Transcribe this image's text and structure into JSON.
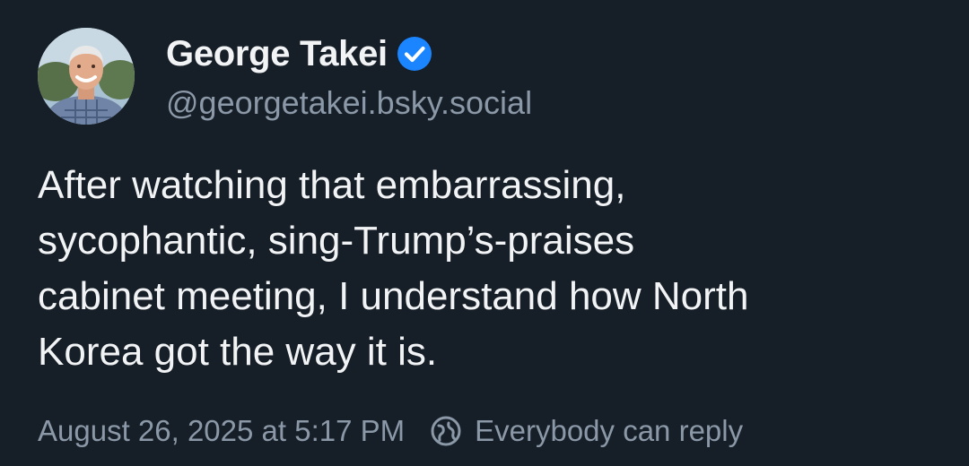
{
  "author": {
    "display_name": "George Takei",
    "handle": "@georgetakei.bsky.social",
    "verified": true,
    "avatar_icon": "avatar-photo"
  },
  "post": {
    "text": "After watching that embarrassing,\nsycophantic, sing-Trump’s-praises\ncabinet meeting, I understand how North\nKorea got the way it is."
  },
  "meta": {
    "timestamp": "August 26, 2025 at 5:17 PM",
    "reply_setting": "Everybody can reply",
    "reply_icon": "globe-reply-icon"
  },
  "colors": {
    "background": "#161e27",
    "text": "#f1f3f5",
    "muted": "#8b98a7",
    "verified_badge": "#1a85ff"
  }
}
